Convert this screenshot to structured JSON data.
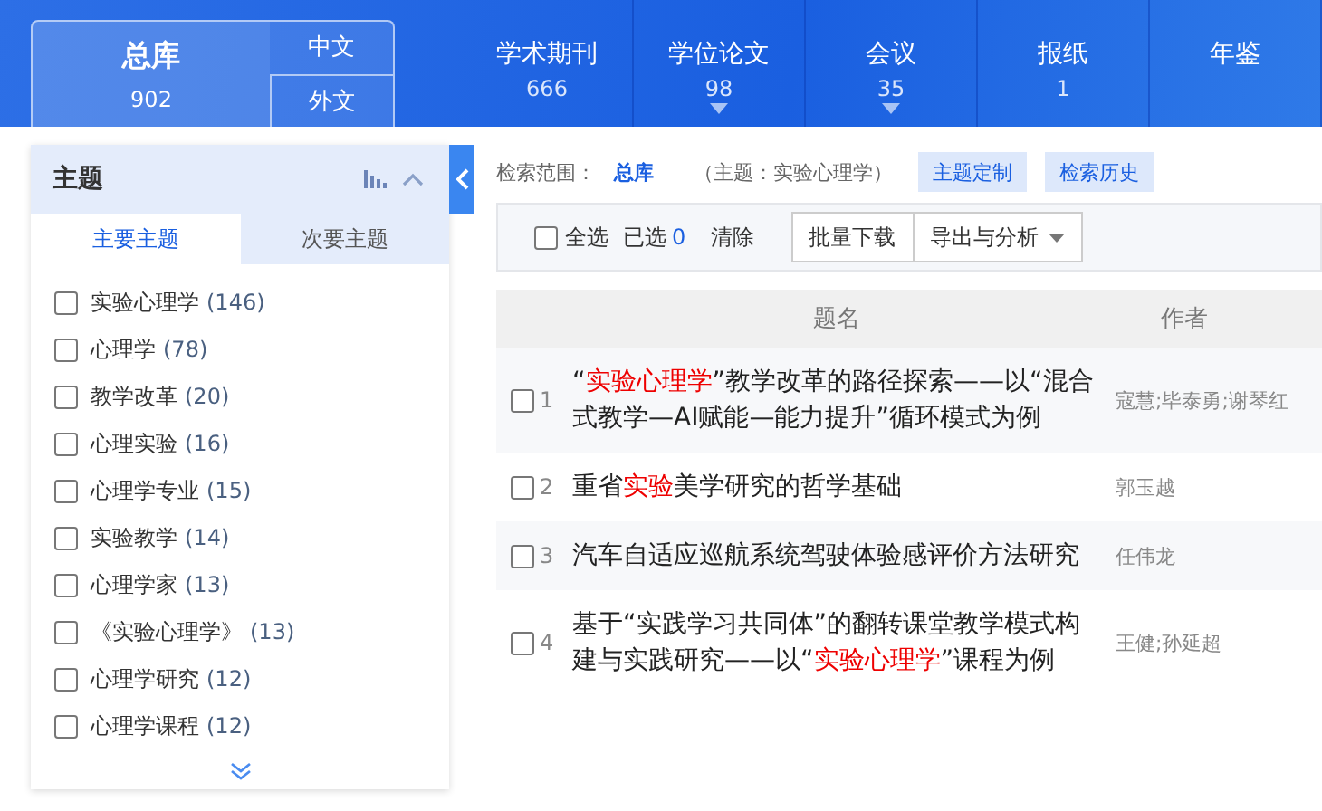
{
  "db_nav": {
    "total": {
      "label": "总库",
      "count": "902",
      "selected": true
    },
    "langs": [
      {
        "label": "中文",
        "selected": false
      },
      {
        "label": "外文",
        "selected": false
      }
    ],
    "items": [
      {
        "label": "学术期刊",
        "count": "666",
        "expandable": false
      },
      {
        "label": "学位论文",
        "count": "98",
        "expandable": true
      },
      {
        "label": "会议",
        "count": "35",
        "expandable": true
      },
      {
        "label": "报纸",
        "count": "1",
        "expandable": false
      },
      {
        "label": "年鉴",
        "expandable": false
      }
    ]
  },
  "facet": {
    "title": "主题",
    "expanded": true,
    "tabs": [
      {
        "label": "主要主题",
        "selected": true
      },
      {
        "label": "次要主题",
        "selected": false
      }
    ],
    "items": [
      {
        "label": "实验心理学",
        "count": "(146)",
        "checked": false
      },
      {
        "label": "心理学",
        "count": "(78)",
        "checked": false
      },
      {
        "label": "教学改革",
        "count": "(20)",
        "checked": false
      },
      {
        "label": "心理实验",
        "count": "(16)",
        "checked": false
      },
      {
        "label": "心理学专业",
        "count": "(15)",
        "checked": false
      },
      {
        "label": "实验教学",
        "count": "(14)",
        "checked": false
      },
      {
        "label": "心理学家",
        "count": "(13)",
        "checked": false
      },
      {
        "label": "《实验心理学》",
        "count": "(13)",
        "checked": false
      },
      {
        "label": "心理学研究",
        "count": "(12)",
        "checked": false
      },
      {
        "label": "心理学课程",
        "count": "(12)",
        "checked": false
      }
    ]
  },
  "scope": {
    "label": "检索范围：",
    "value": "总库",
    "query": "（主题：实验心理学）",
    "buttons": [
      "主题定制",
      "检索历史"
    ]
  },
  "toolbar": {
    "select_all": {
      "label": "全选",
      "checked": false
    },
    "selected_label": "已选",
    "selected_count": "0",
    "clear": "清除",
    "buttons": [
      {
        "label": "批量下载",
        "dropdown": false
      },
      {
        "label": "导出与分析",
        "dropdown": true
      }
    ]
  },
  "table": {
    "columns": [
      "题名",
      "作者"
    ],
    "rows": [
      {
        "checked": false,
        "index": "1",
        "title": [
          {
            "text": "“",
            "hit": false
          },
          {
            "text": "实验心理学",
            "hit": true
          },
          {
            "text": "”教学改革的路径探索——以“混合式教学—AI赋能—能力提升”循环模式为例",
            "hit": false
          }
        ],
        "authors": "寇慧;毕泰勇;谢琴红"
      },
      {
        "checked": false,
        "index": "2",
        "title": [
          {
            "text": "重省",
            "hit": false
          },
          {
            "text": "实验",
            "hit": true
          },
          {
            "text": "美学研究的哲学基础",
            "hit": false
          }
        ],
        "authors": "郭玉越"
      },
      {
        "checked": false,
        "index": "3",
        "title": [
          {
            "text": "汽车自适应巡航系统驾驶体验感评价方法研究",
            "hit": false
          }
        ],
        "authors": "任伟龙"
      },
      {
        "checked": false,
        "index": "4",
        "title": [
          {
            "text": "基于“实践学习共同体”的翻转课堂教学模式构建与实践研究——以“",
            "hit": false
          },
          {
            "text": "实验心理学",
            "hit": true
          },
          {
            "text": "”课程为例",
            "hit": false
          }
        ],
        "authors": "王健;孙延超"
      }
    ]
  }
}
